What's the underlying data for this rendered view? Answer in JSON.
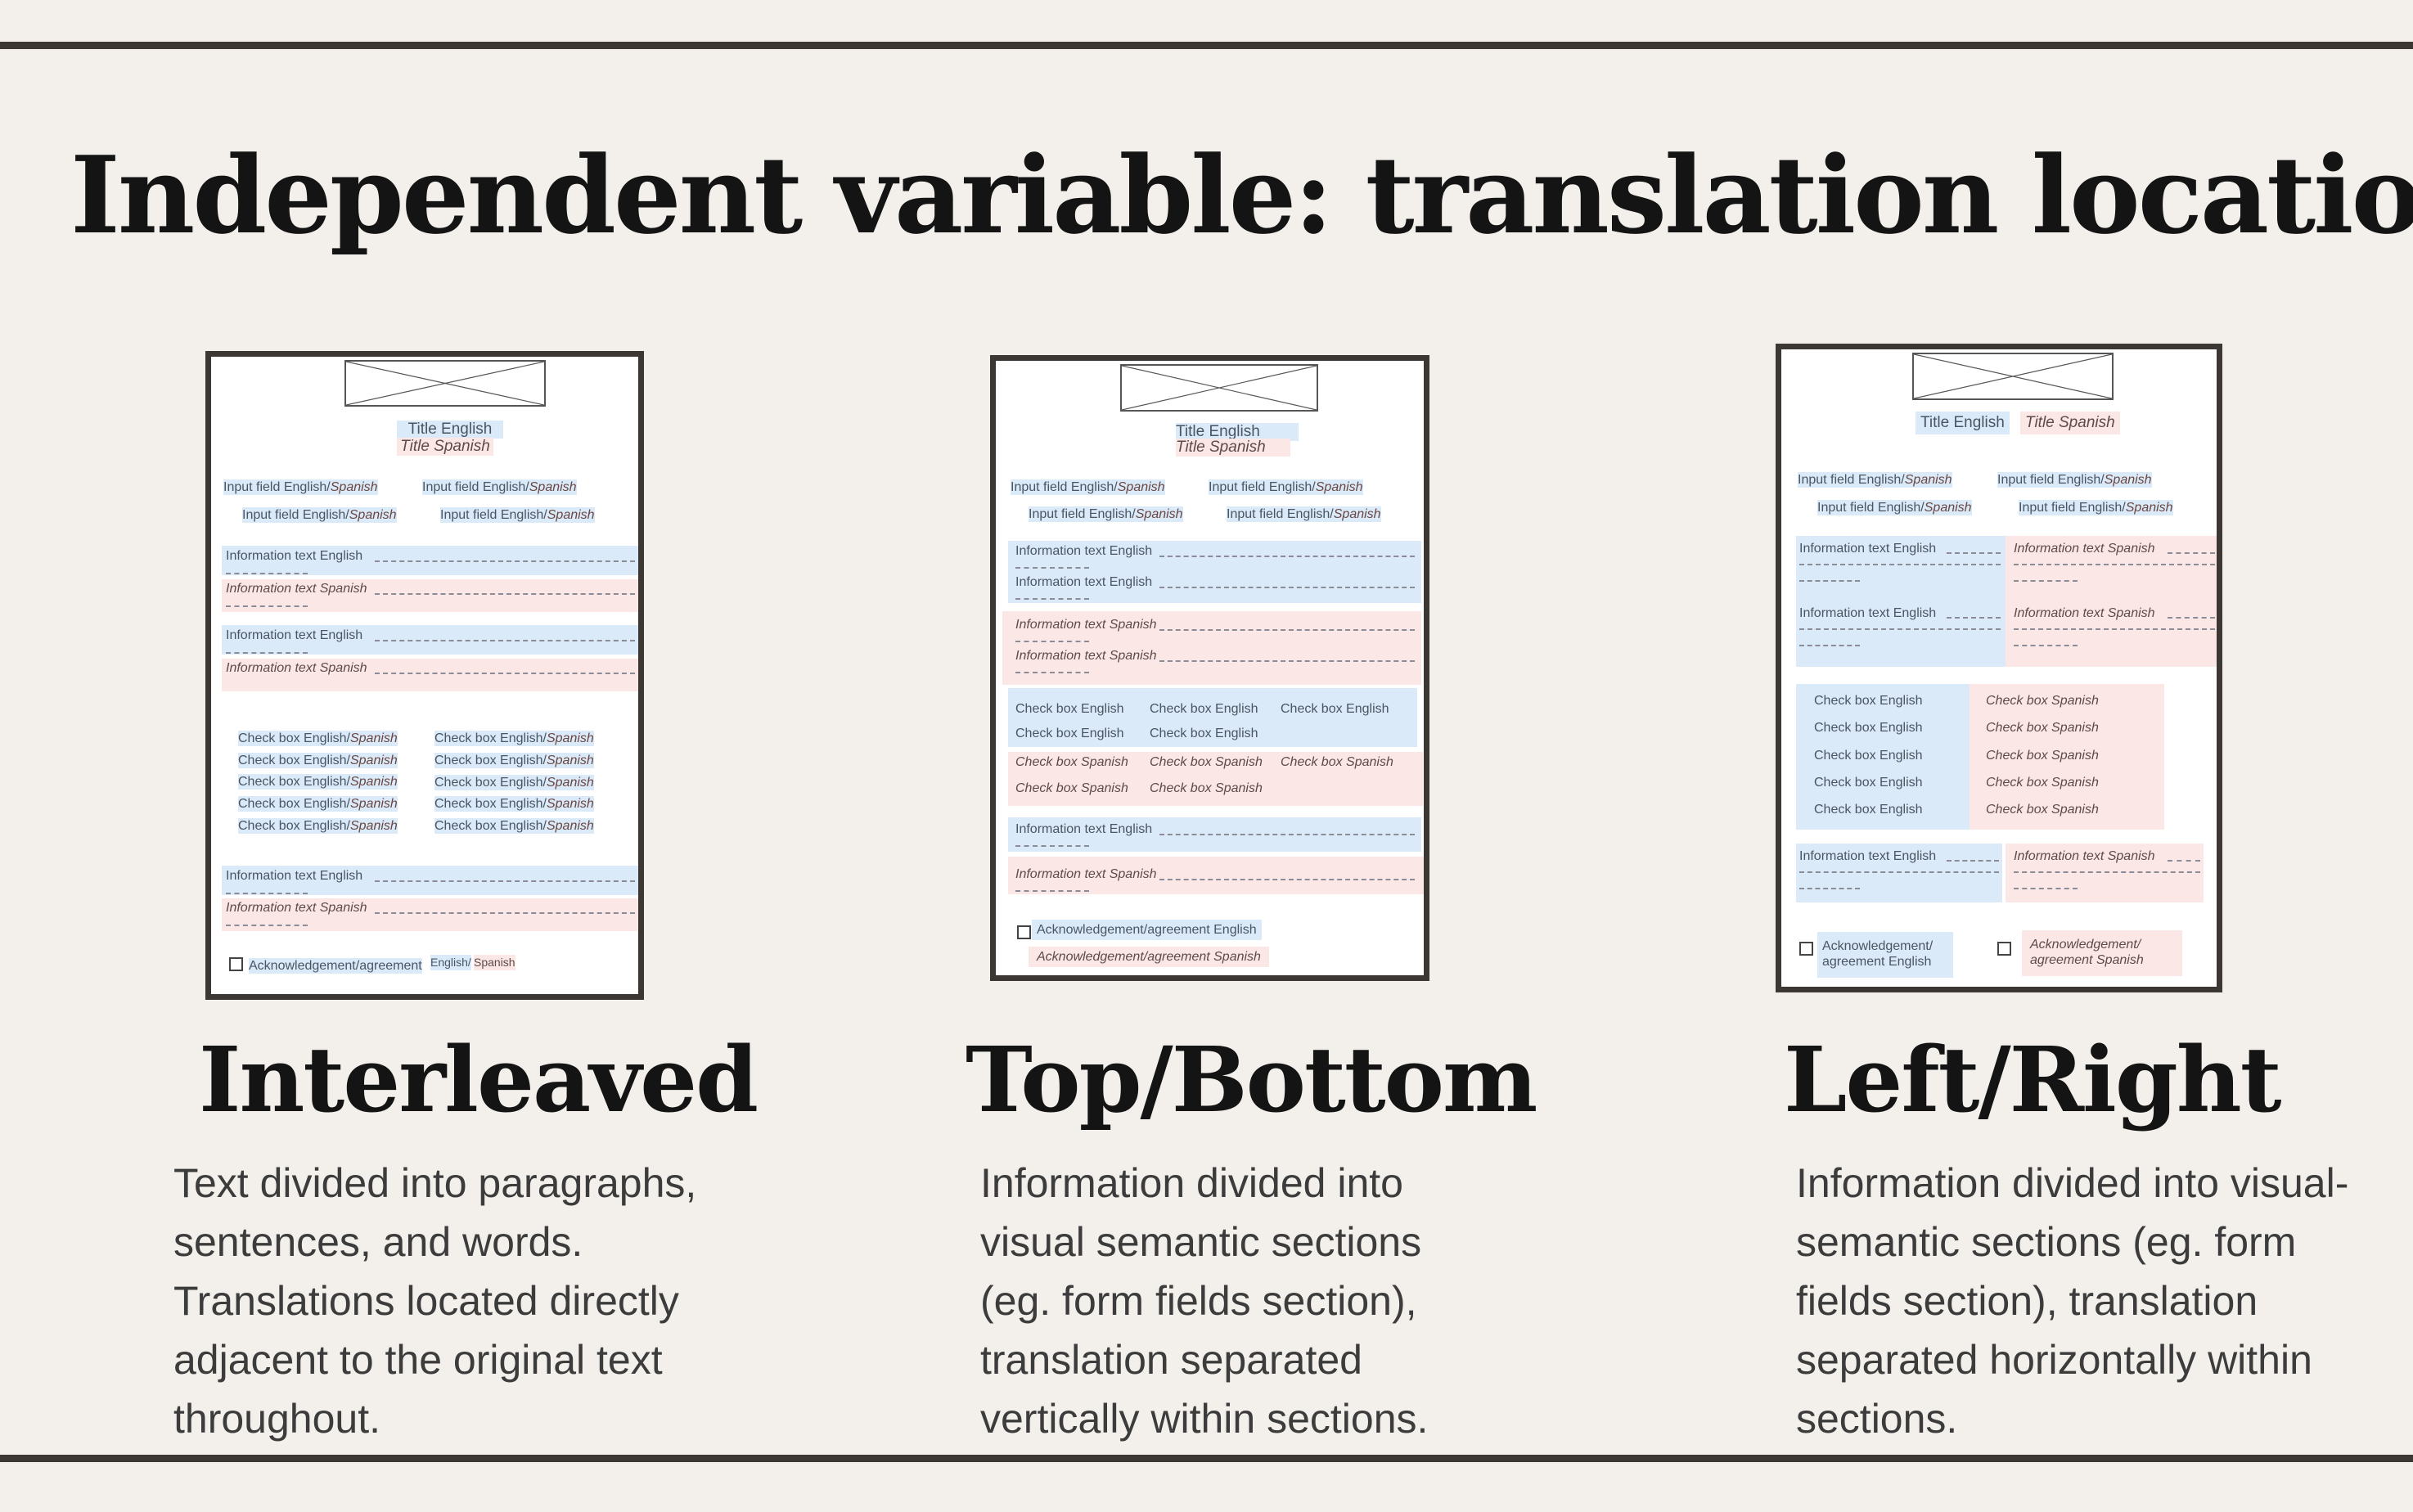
{
  "slide": {
    "title": "Independent variable: translation location"
  },
  "columns": [
    {
      "label": "Interleaved",
      "description": "Text divided into paragraphs, sentences, and words. Translations located directly adjacent to the original text throughout."
    },
    {
      "label": "Top/Bottom",
      "description": "Information divided into visual semantic sections (eg. form fields section), translation separated vertically within sections."
    },
    {
      "label": "Left/Right",
      "description": "Information divided into visual-semantic sections (eg. form fields section), translation separated horizontally within sections."
    }
  ],
  "mockup_text": {
    "title_en": "Title English",
    "title_es": "Title Spanish",
    "input_en": "Input field English/",
    "spanish": "Spanish",
    "info_en": "Information text English",
    "info_es": "Information text Spanish",
    "checkbox_en": "Check box English",
    "checkbox_es": "Check box Spanish",
    "checkbox_en_slash": "Check box English/",
    "ack_en": "Acknowledgement/agreement English",
    "ack_es": "Acknowledgement/agreement Spanish",
    "ack_interleaved": "Acknowledgement/agreement",
    "english_slash": "English/",
    "ack_lr_en_1": "Acknowledgement/",
    "ack_lr_en_2": "agreement English",
    "ack_lr_es_1": "Acknowledgement/",
    "ack_lr_es_2": "agreement Spanish"
  },
  "colors": {
    "background": "#f3f0eb",
    "rule": "#3d3734",
    "english_highlight": "#dbeaf8",
    "spanish_highlight": "#fbe7e5"
  }
}
